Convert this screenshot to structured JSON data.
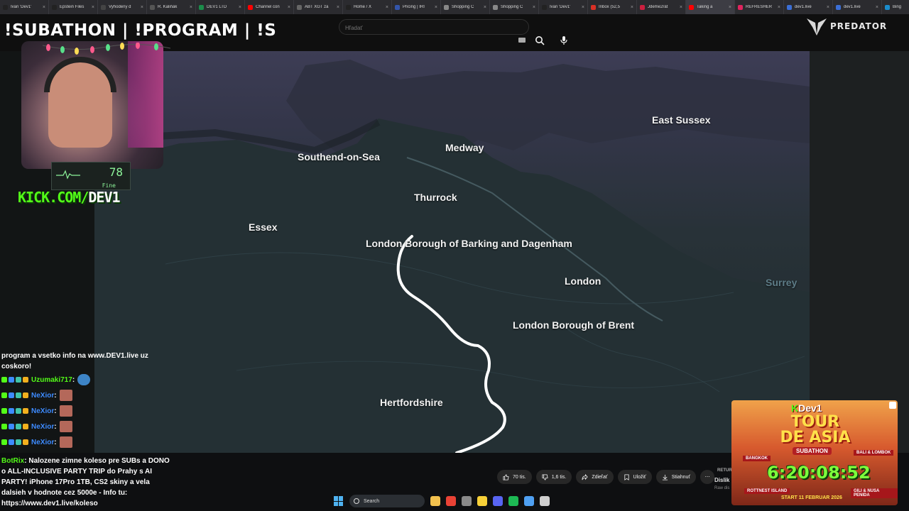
{
  "browser": {
    "tabs": [
      {
        "label": "Ivan 'Dev1'",
        "color": "#222222"
      },
      {
        "label": "Epstein Files",
        "color": "#222222"
      },
      {
        "label": "Vyhodeny d",
        "color": "#444444"
      },
      {
        "label": "R. Kaliňák",
        "color": "#555555"
      },
      {
        "label": "DEV1 LTD",
        "color": "#1b8c4a"
      },
      {
        "label": "Channel con",
        "color": "#ff0000"
      },
      {
        "label": "ABT XGT zá",
        "color": "#666666"
      },
      {
        "label": "Home / X",
        "color": "#222222"
      },
      {
        "label": "Pricing | IRI",
        "color": "#3355aa"
      },
      {
        "label": "Shopping C",
        "color": "#888888"
      },
      {
        "label": "Shopping C",
        "color": "#888888"
      },
      {
        "label": "Ivan 'Dev1'",
        "color": "#222222"
      },
      {
        "label": "Inbox (52,5",
        "color": "#d93025"
      },
      {
        "label": "Jdeme2rát",
        "color": "#cc1f3f"
      },
      {
        "label": "Taking a",
        "color": "#ff0000",
        "active": true
      },
      {
        "label": "REFRESHER",
        "color": "#e0245e"
      },
      {
        "label": "dev1.live",
        "color": "#3b6fd6"
      },
      {
        "label": "dev1.live",
        "color": "#3b6fd6"
      },
      {
        "label": "Bing",
        "color": "#1a8ccc"
      }
    ],
    "close_glyph": "×"
  },
  "overlay": {
    "stream_title": "!SUBATHON | !PROGRAM | !S",
    "heart_rate_value": "78",
    "heart_rate_status": "Fine",
    "kick_url_prefix": "KICK.COM/",
    "kick_url_name": "DEV1"
  },
  "header": {
    "search_placeholder": "Hľadať",
    "brand": "PREDATOR"
  },
  "map": {
    "labels": [
      {
        "text": "East Sussex"
      },
      {
        "text": "Medway"
      },
      {
        "text": "Southend-on-Sea"
      },
      {
        "text": "Thurrock"
      },
      {
        "text": "Essex"
      },
      {
        "text": "London Borough of Barking and Dagenham"
      },
      {
        "text": "London"
      },
      {
        "text": "Surrey",
        "faint": true
      },
      {
        "text": "London Borough of Brent"
      },
      {
        "text": "Hertfordshire"
      }
    ]
  },
  "chat": {
    "top_message": "program a vsetko info na www.DEV1.live uz coskoro!",
    "rows": [
      {
        "name": "Uzumaki717",
        "name_color": "#53fc18",
        "emote": "blue"
      },
      {
        "name": "NeXior",
        "name_color": "#3d8bff",
        "emote": "face"
      },
      {
        "name": "NeXior",
        "name_color": "#3d8bff",
        "emote": "face"
      },
      {
        "name": "NeXior",
        "name_color": "#3d8bff",
        "emote": "face"
      },
      {
        "name": "NeXior",
        "name_color": "#3d8bff",
        "emote": "face"
      }
    ],
    "bot_name": "BotRix",
    "bot_message": "Nalozene zimne koleso pre SUBs a DONO o ALL-INCLUSIVE PARTY TRIP do Prahy s AI PARTY! iPhone 17Pro 1TB, CS2 skiny a vela dalsieh v hodnote cez 5000e - Info tu: https://www.dev1.live/koleso"
  },
  "video_actions": {
    "likes": "70 tis.",
    "dislikes": "1,6 tis.",
    "share": "Zdieľať",
    "save": "Uložiť",
    "download": "Stiahnuť",
    "more": "⋯",
    "return_label": "RETUR",
    "dislike_title": "Dislik",
    "dislike_sub": "Raw dis"
  },
  "poster": {
    "brand_k": "K",
    "brand": "Dev1",
    "title": "TOUR DE ASIA",
    "subtitle": "SUBATHON",
    "bangkok": "BANGKOK",
    "bali": "BALI & LOMBOK",
    "timer": "6:20:08:52",
    "rott": "ROTTNEST ISLAND",
    "gili": "GILI & NUSA PENIDA",
    "start": "START 11 FEBRUAR 2026"
  },
  "taskbar": {
    "search_label": "Search",
    "apps": [
      {
        "name": "file-explorer-icon",
        "color": "#f2c14e"
      },
      {
        "name": "chrome-icon",
        "color": "#e94235"
      },
      {
        "name": "settings-icon",
        "color": "#8a8a8a"
      },
      {
        "name": "notes-icon",
        "color": "#f7d038"
      },
      {
        "name": "discord-icon",
        "color": "#5865f2"
      },
      {
        "name": "spotify-icon",
        "color": "#1db954"
      },
      {
        "name": "docs-icon",
        "color": "#4fa0f2"
      },
      {
        "name": "obs-icon",
        "color": "#cfcfcf"
      }
    ]
  }
}
